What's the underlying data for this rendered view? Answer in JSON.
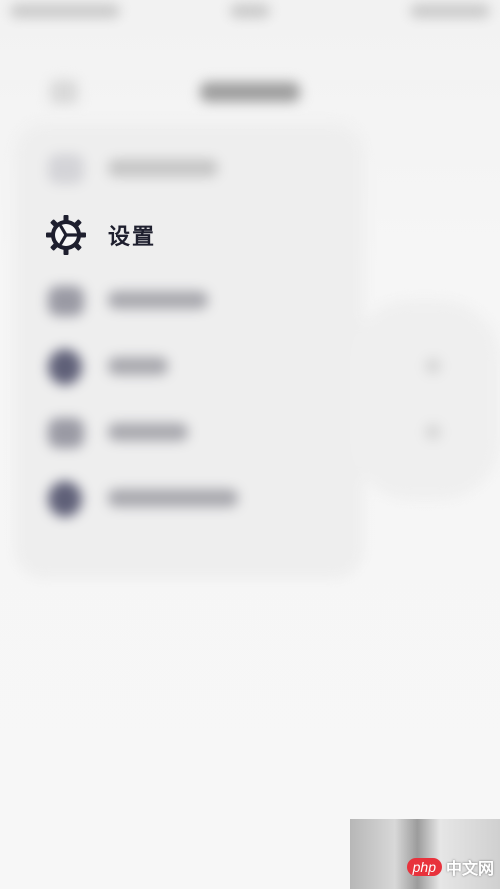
{
  "settings": {
    "label": "设置",
    "icon": "settings-gear-icon"
  },
  "watermark": {
    "logo": "php",
    "site": "中文网"
  },
  "colors": {
    "accent": "#1e1f2e",
    "watermark_logo": "#e8323c",
    "background": "#f7f7f7"
  }
}
